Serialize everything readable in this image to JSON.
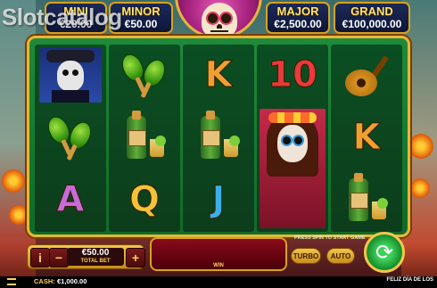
{
  "watermark": "Slotcatalog",
  "jackpots": [
    {
      "label": "MINI",
      "value": "€20.00"
    },
    {
      "label": "MINOR",
      "value": "€50.00"
    },
    {
      "label": "MAJOR",
      "value": "€2,500.00"
    },
    {
      "label": "GRAND",
      "value": "€100,000.00"
    }
  ],
  "reels": [
    [
      "man-symbol",
      "maracas-symbol",
      "A"
    ],
    [
      "maracas-symbol",
      "tequila-symbol",
      "Q"
    ],
    [
      "K",
      "tequila-symbol",
      "J"
    ],
    [
      "10",
      "woman-symbol",
      "woman-symbol"
    ],
    [
      "guitar-symbol",
      "K",
      "tequila-symbol"
    ]
  ],
  "colors": {
    "A": "#c86ad8",
    "K": "#f0a030",
    "Q": "#f4c23a",
    "J": "#3ab0e8",
    "10": "#e83a3a"
  },
  "bet": {
    "value": "€50.00",
    "label": "TOTAL BET",
    "info_icon": "i",
    "minus": "−",
    "plus": "+"
  },
  "win": {
    "label": "WIN"
  },
  "hint": "PRESS SPIN TO START GAME",
  "buttons": {
    "turbo": "TURBO",
    "auto": "AUTO",
    "spin_icon": "⟳"
  },
  "status": {
    "cash_label": "CASH:",
    "cash_value": "€1,000.00",
    "title": "FELIZ DÍA DE LOS"
  }
}
